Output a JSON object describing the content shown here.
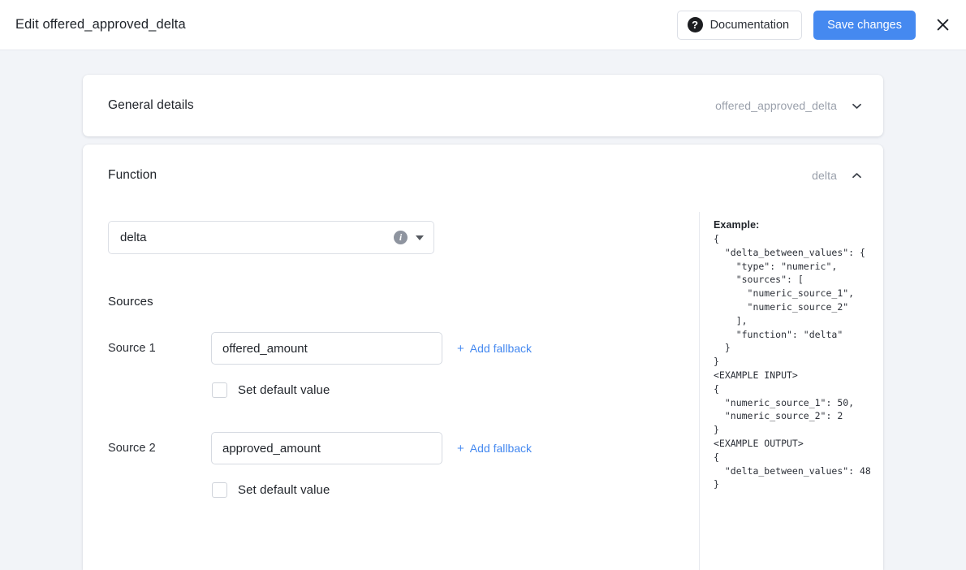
{
  "header": {
    "title": "Edit offered_approved_delta",
    "documentation_label": "Documentation",
    "documentation_icon": "question-circle-icon",
    "save_label": "Save changes",
    "close_icon": "close-icon",
    "accent_color": "#4589f0"
  },
  "cards": {
    "general_details": {
      "title": "General details",
      "summary_value": "offered_approved_delta",
      "chevron_icon": "chevron-down-icon",
      "expanded": false
    },
    "function": {
      "title": "Function",
      "summary_value": "delta",
      "chevron_icon": "chevron-up-icon",
      "expanded": true,
      "function_select": {
        "value": "delta",
        "info_icon": "info-icon",
        "caret_icon": "caret-down-icon"
      },
      "sources_label": "Sources",
      "sources": [
        {
          "label": "Source 1",
          "value": "offered_amount",
          "placeholder": "",
          "fallback_label": "Add fallback",
          "fallback_plus": "+",
          "default_label": "Set default value",
          "default_checked": false
        },
        {
          "label": "Source 2",
          "value": "approved_amount",
          "placeholder": "",
          "fallback_label": "Add fallback",
          "fallback_plus": "+",
          "default_label": "Set default value",
          "default_checked": false
        }
      ],
      "example": {
        "title": "Example:",
        "code": "{\n  \"delta_between_values\": {\n    \"type\": \"numeric\",\n    \"sources\": [\n      \"numeric_source_1\",\n      \"numeric_source_2\"\n    ],\n    \"function\": \"delta\"\n  }\n}\n<EXAMPLE INPUT>\n{\n  \"numeric_source_1\": 50,\n  \"numeric_source_2\": 2\n}\n<EXAMPLE OUTPUT>\n{\n  \"delta_between_values\": 48\n}"
      }
    }
  }
}
